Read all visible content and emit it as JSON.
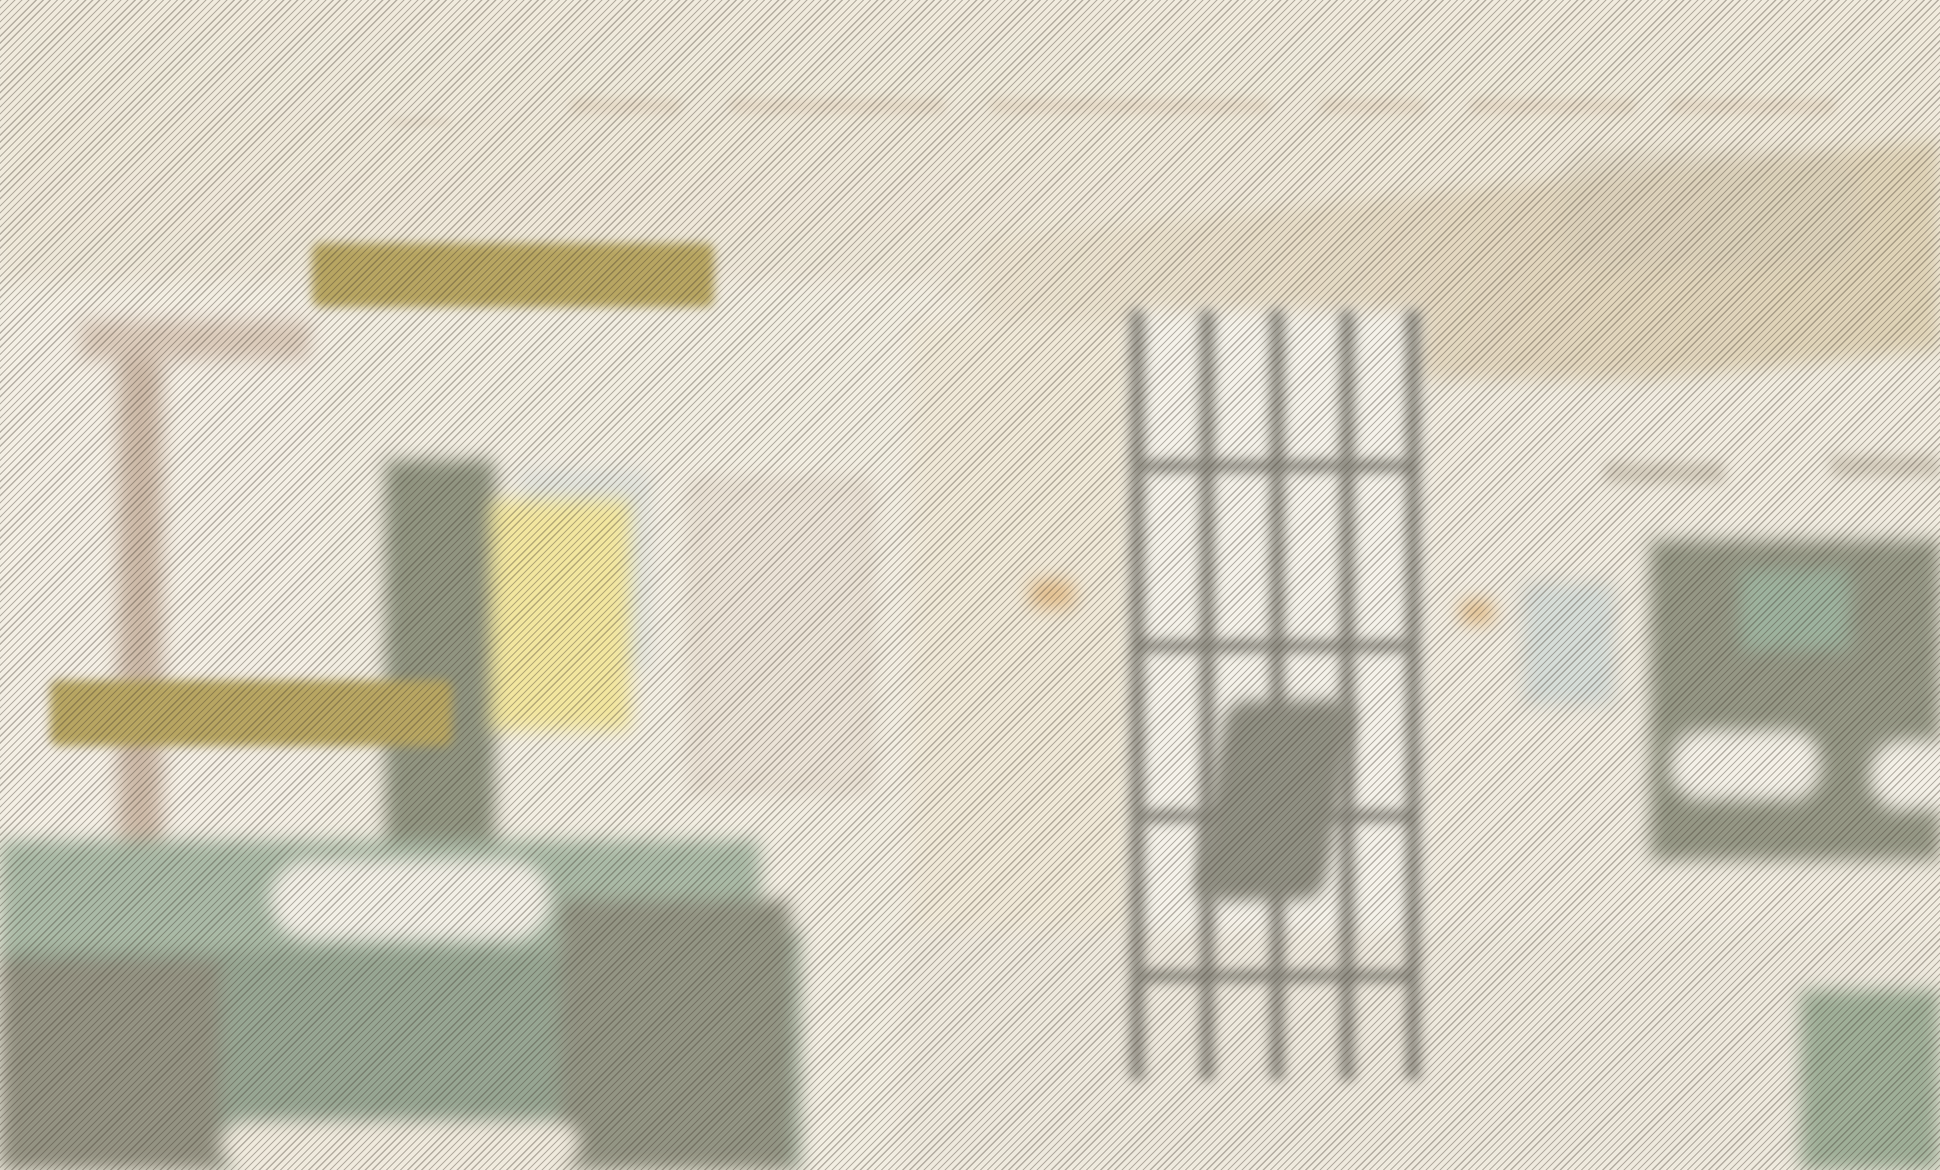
{
  "site": {
    "logo_text": "",
    "nav": [
      {
        "label": ""
      },
      {
        "label": ""
      },
      {
        "label": ""
      },
      {
        "label": ""
      },
      {
        "label": ""
      },
      {
        "label": ""
      }
    ]
  },
  "hero": {
    "badge_top": "",
    "badge_bottom": ""
  },
  "colors": {
    "accent_gold": "#b8a662",
    "vanity_green": "#607b66",
    "wall_cream": "#f1ede3"
  }
}
